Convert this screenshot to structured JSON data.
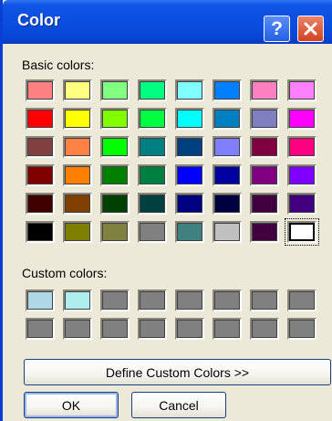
{
  "window": {
    "title": "Color"
  },
  "titlebar": {
    "help_symbol": "?"
  },
  "basic": {
    "label": "Basic colors:",
    "colors": [
      "#ff8080",
      "#ffff80",
      "#80ff80",
      "#00ff80",
      "#80ffff",
      "#0080ff",
      "#ff80c0",
      "#ff80ff",
      "#ff0000",
      "#ffff00",
      "#80ff00",
      "#00ff40",
      "#00ffff",
      "#0080c0",
      "#8080c0",
      "#ff00ff",
      "#804040",
      "#ff8040",
      "#00ff00",
      "#008080",
      "#004080",
      "#8080ff",
      "#800040",
      "#ff0080",
      "#800000",
      "#ff8000",
      "#008000",
      "#008040",
      "#0000ff",
      "#0000a0",
      "#800080",
      "#8000ff",
      "#400000",
      "#804000",
      "#004000",
      "#004040",
      "#000080",
      "#000040",
      "#400040",
      "#400080",
      "#000000",
      "#808000",
      "#808040",
      "#808080",
      "#408080",
      "#c0c0c0",
      "#400040",
      "#ffffff"
    ],
    "selected_index": 47
  },
  "custom": {
    "label": "Custom colors:",
    "colors": [
      "#add8e6",
      "#afeeee",
      "#808080",
      "#808080",
      "#808080",
      "#808080",
      "#808080",
      "#808080",
      "#808080",
      "#808080",
      "#808080",
      "#808080",
      "#808080",
      "#808080",
      "#808080",
      "#808080"
    ]
  },
  "buttons": {
    "define": "Define Custom Colors >>",
    "ok": "OK",
    "cancel": "Cancel"
  }
}
